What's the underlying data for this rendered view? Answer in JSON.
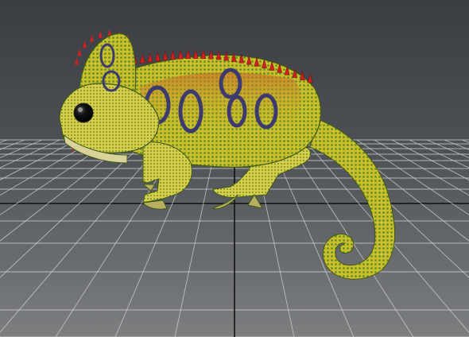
{
  "viewport": {
    "background_top": "#3a3d42",
    "background_bottom": "#7c7e80",
    "grid_color": "#d4d6d8",
    "axis_color": "#111111"
  },
  "model": {
    "subject": "chameleon",
    "skin_yellow": "#c9c02a",
    "skin_green": "#5f8a2a",
    "skin_orange": "#c96a2a",
    "ring_purple": "#5a4c8a",
    "spike_red": "#d02020",
    "eye_color": "#050505"
  }
}
